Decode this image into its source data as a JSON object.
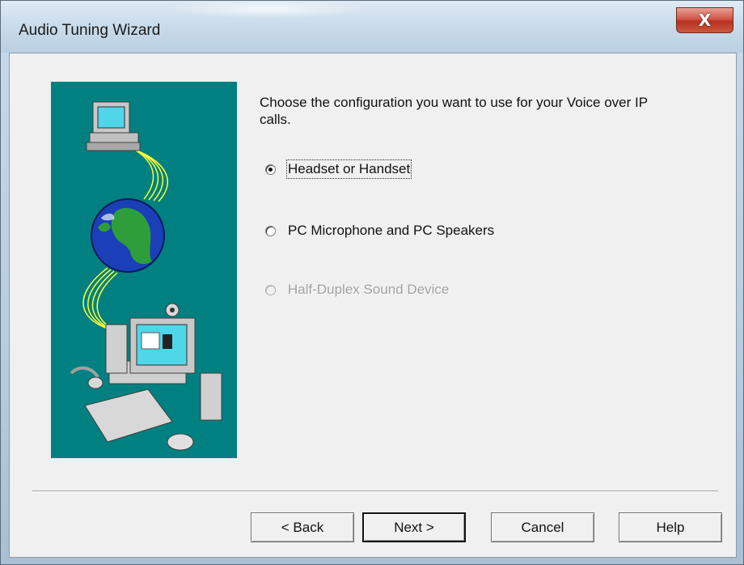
{
  "window": {
    "title": "Audio Tuning Wizard",
    "close_label": "X"
  },
  "prompt": "Choose the configuration you want to use for your Voice over IP calls.",
  "options": [
    {
      "label": "Headset or Handset",
      "checked": true,
      "enabled": true
    },
    {
      "label": "PC Microphone and PC Speakers",
      "checked": false,
      "enabled": true
    },
    {
      "label": "Half-Duplex Sound Device",
      "checked": false,
      "enabled": false
    }
  ],
  "buttons": {
    "back": "< Back",
    "next": "Next >",
    "cancel": "Cancel",
    "help": "Help"
  },
  "colors": {
    "illustration_bg": "#008080",
    "dialog_bg": "#f0f0f0",
    "close_button": "#c9402e"
  },
  "icons": [
    "computer-monitor-icon",
    "globe-icon",
    "desktop-computer-icon",
    "keyboard-icon",
    "mouse-icon",
    "webcam-icon",
    "speaker-icon",
    "headset-icon"
  ]
}
